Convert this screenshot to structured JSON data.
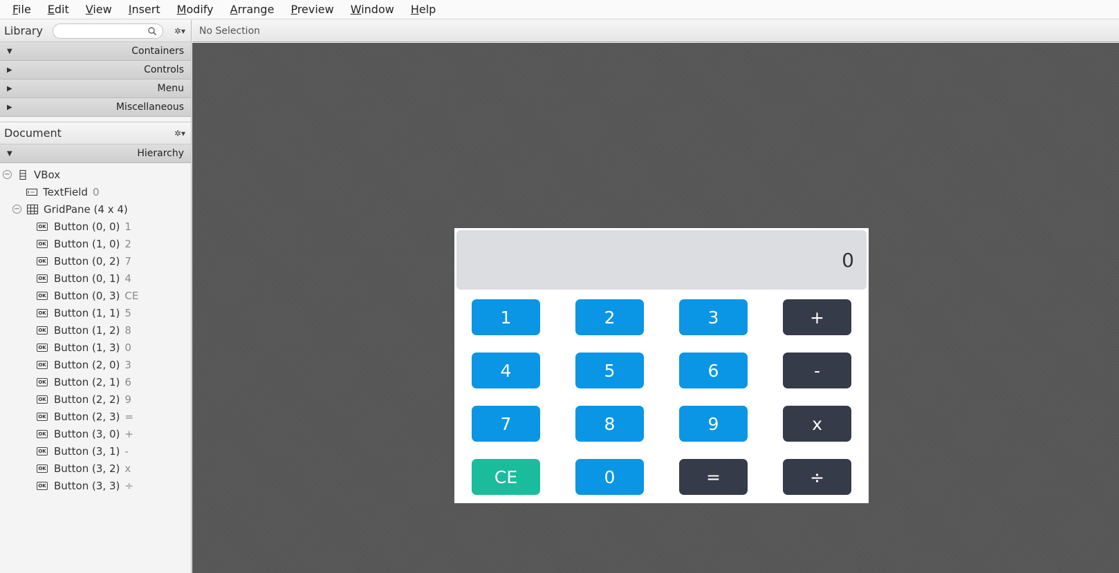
{
  "menubar": [
    {
      "mn": "F",
      "rest": "ile"
    },
    {
      "mn": "E",
      "rest": "dit"
    },
    {
      "mn": "V",
      "rest": "iew"
    },
    {
      "mn": "I",
      "rest": "nsert"
    },
    {
      "mn": "M",
      "rest": "odify"
    },
    {
      "mn": "A",
      "rest": "rrange"
    },
    {
      "mn": "P",
      "rest": "review"
    },
    {
      "mn": "W",
      "rest": "indow"
    },
    {
      "mn": "H",
      "rest": "elp"
    }
  ],
  "library": {
    "title": "Library",
    "search_value": "",
    "sections": [
      "Containers",
      "Controls",
      "Menu",
      "Miscellaneous"
    ]
  },
  "document": {
    "title": "Document",
    "hierarchy_label": "Hierarchy",
    "tree": [
      {
        "label": "VBox",
        "value": ""
      },
      {
        "label": "TextField",
        "value": "0"
      },
      {
        "label": "GridPane (4 x 4)",
        "value": ""
      },
      {
        "label": "Button (0, 0)",
        "value": "1"
      },
      {
        "label": "Button (1, 0)",
        "value": "2"
      },
      {
        "label": "Button (0, 2)",
        "value": "7"
      },
      {
        "label": "Button (0, 1)",
        "value": "4"
      },
      {
        "label": "Button (0, 3)",
        "value": "CE"
      },
      {
        "label": "Button (1, 1)",
        "value": "5"
      },
      {
        "label": "Button (1, 2)",
        "value": "8"
      },
      {
        "label": "Button (1, 3)",
        "value": "0"
      },
      {
        "label": "Button (2, 0)",
        "value": "3"
      },
      {
        "label": "Button (2, 1)",
        "value": "6"
      },
      {
        "label": "Button (2, 2)",
        "value": "9"
      },
      {
        "label": "Button (2, 3)",
        "value": "="
      },
      {
        "label": "Button (3, 0)",
        "value": "+"
      },
      {
        "label": "Button (3, 1)",
        "value": "-"
      },
      {
        "label": "Button (3, 2)",
        "value": "x"
      },
      {
        "label": "Button (3, 3)",
        "value": "÷"
      }
    ]
  },
  "content": {
    "selection_status": "No Selection"
  },
  "calculator": {
    "display_value": "0",
    "buttons": [
      "1",
      "2",
      "3",
      "+",
      "4",
      "5",
      "6",
      "-",
      "7",
      "8",
      "9",
      "x",
      "CE",
      "0",
      "=",
      "÷"
    ],
    "colors": {
      "digit": "#0a96e5",
      "operator": "#353b48",
      "clear": "#1abc9c",
      "display_bg": "#dcdde1"
    }
  }
}
